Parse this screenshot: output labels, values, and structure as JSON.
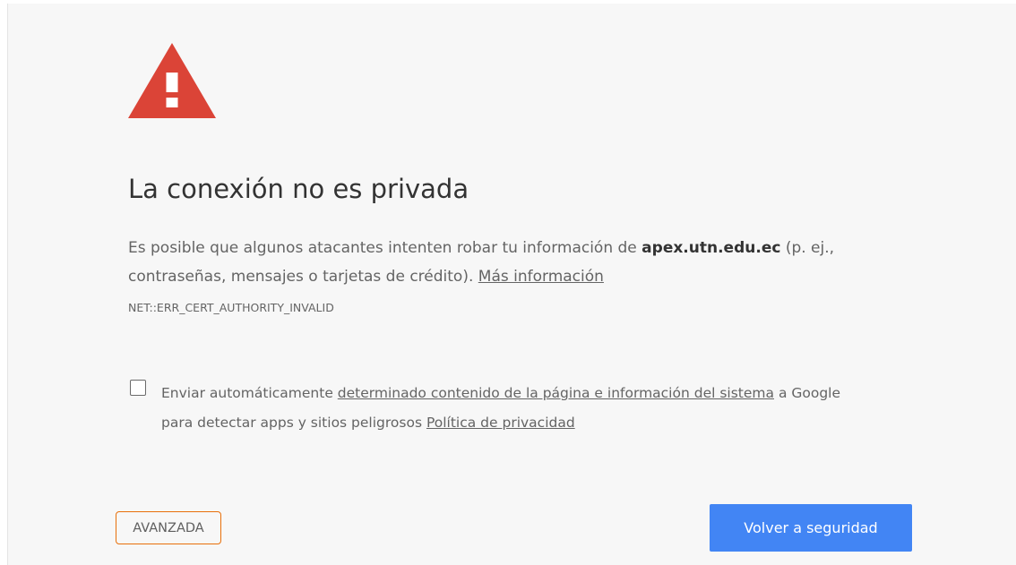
{
  "icon": {
    "name": "warning-triangle-icon",
    "color": "#db4437",
    "glyph_color": "#ffffff"
  },
  "title": "La conexión no es privada",
  "description": {
    "prefix": "Es posible que algunos atacantes intenten robar tu información de ",
    "host": "apex.utn.edu.ec",
    "suffix": " (p. ej., contraseñas, mensajes o tarjetas de crédito). ",
    "learn_more": "Más información"
  },
  "error_code": "NET::ERR_CERT_AUTHORITY_INVALID",
  "report": {
    "checked": false,
    "prefix": "Enviar automáticamente ",
    "link": "determinado contenido de la página e información del sistema",
    "after_link": " a Google",
    "line2": "para detectar apps y sitios peligrosos ",
    "privacy_link": "Política de privacidad"
  },
  "buttons": {
    "advanced": "AVANZADA",
    "back_to_safety": "Volver a seguridad"
  },
  "colors": {
    "background": "#f7f7f7",
    "primary": "#4285f4",
    "focus_ring": "#e8700a",
    "warning": "#db4437"
  }
}
